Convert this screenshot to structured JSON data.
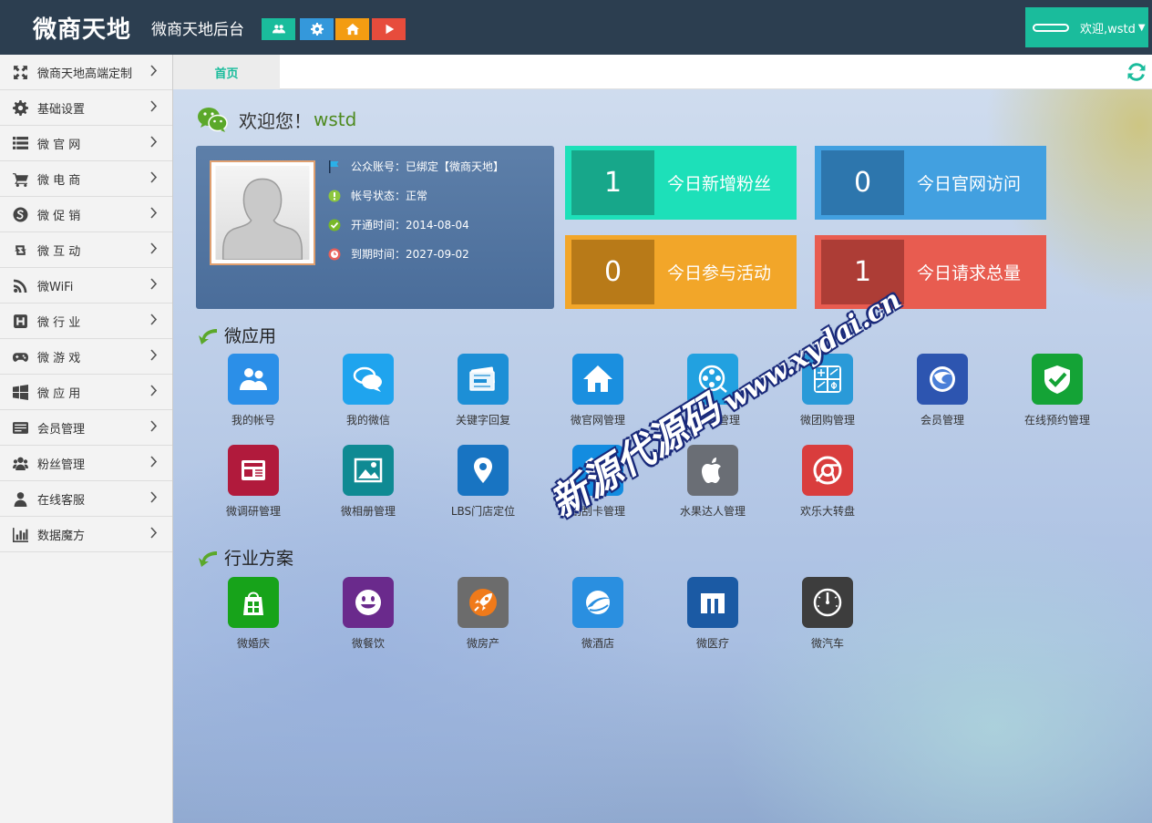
{
  "header": {
    "logo": "微商天地",
    "subtitle": "微商天地后台",
    "buttons": [
      {
        "icon": "users-icon",
        "color": "#1abc9c"
      },
      {
        "icon": "gear-icon",
        "color": "#3498db"
      },
      {
        "icon": "home-icon",
        "color": "#f39c12"
      },
      {
        "icon": "play-icon",
        "color": "#e74c3c"
      }
    ],
    "welcome": "欢迎,wstd",
    "welcome_caret": "▼"
  },
  "sidebar": {
    "items": [
      {
        "label": "微商天地高端定制",
        "icon": "expand-icon"
      },
      {
        "label": "基础设置",
        "icon": "gear-icon"
      },
      {
        "label": "微 官 网",
        "icon": "list-icon"
      },
      {
        "label": "微 电 商",
        "icon": "cart-icon"
      },
      {
        "label": "微 促 销",
        "icon": "skype-icon"
      },
      {
        "label": "微 互 动",
        "icon": "retweet-icon"
      },
      {
        "label": "微WiFi",
        "icon": "rss-icon"
      },
      {
        "label": "微 行 业",
        "icon": "h-square-icon"
      },
      {
        "label": "微 游 戏",
        "icon": "gamepad-icon"
      },
      {
        "label": "微 应 用",
        "icon": "windows-icon"
      },
      {
        "label": "会员管理",
        "icon": "card-icon"
      },
      {
        "label": "粉丝管理",
        "icon": "users-icon"
      },
      {
        "label": "在线客服",
        "icon": "user-icon"
      },
      {
        "label": "数据魔方",
        "icon": "chart-icon"
      }
    ]
  },
  "tabs": {
    "home": "首页"
  },
  "greeting": {
    "prefix": "欢迎您！",
    "user": "wstd"
  },
  "profile": {
    "lines": [
      {
        "text": "公众账号：已绑定【微商天地】",
        "icon": "flag-icon"
      },
      {
        "text": "帐号状态：正常",
        "icon": "info-icon"
      },
      {
        "text": "开通时间：2014-08-04",
        "icon": "check-icon"
      },
      {
        "text": "到期时间：2027-09-02",
        "icon": "clock-icon"
      }
    ]
  },
  "stats": [
    {
      "value": "1",
      "label": "今日新增粉丝",
      "bg": "#1de0b9",
      "dark": "#17a78a"
    },
    {
      "value": "0",
      "label": "今日官网访问",
      "bg": "#42a0e0",
      "dark": "#2d76ad"
    },
    {
      "value": "0",
      "label": "今日参与活动",
      "bg": "#f2a629",
      "dark": "#b87a18"
    },
    {
      "value": "1",
      "label": "今日请求总量",
      "bg": "#e85c50",
      "dark": "#ad3d36"
    }
  ],
  "sections": {
    "apps": "微应用",
    "industry": "行业方案"
  },
  "apps": [
    {
      "label": "我的帐号",
      "icon": "users-icon",
      "color": "#2b8fe8"
    },
    {
      "label": "我的微信",
      "icon": "chat-icon",
      "color": "#1fa4ee"
    },
    {
      "label": "关键字回复",
      "icon": "news-icon",
      "color": "#1d8fd6"
    },
    {
      "label": "微官网管理",
      "icon": "home-icon",
      "color": "#1a8fdf"
    },
    {
      "label": "微商城管理",
      "icon": "film-icon",
      "color": "#22a1e0"
    },
    {
      "label": "微团购管理",
      "icon": "calc-icon",
      "color": "#2a9ad8"
    },
    {
      "label": "会员管理",
      "icon": "thunderbird-icon",
      "color": "#2d55b0"
    },
    {
      "label": "在线预约管理",
      "icon": "shield-check-icon",
      "color": "#14a336"
    },
    {
      "label": "微调研管理",
      "icon": "newspaper-icon",
      "color": "#b11a3c"
    },
    {
      "label": "微相册管理",
      "icon": "picture-icon",
      "color": "#0f8a93"
    },
    {
      "label": "LBS门店定位",
      "icon": "location-icon",
      "color": "#1874c2"
    },
    {
      "label": "刮刮卡管理",
      "icon": "dropbox-icon",
      "color": "#138ce0"
    },
    {
      "label": "水果达人管理",
      "icon": "apple-icon",
      "color": "#6a6e75"
    },
    {
      "label": "欢乐大转盘",
      "icon": "chrome-icon",
      "color": "#d93d3d"
    }
  ],
  "industry": [
    {
      "label": "微婚庆",
      "icon": "store-icon",
      "color": "#17a31a"
    },
    {
      "label": "微餐饮",
      "icon": "smiley-icon",
      "color": "#6a2a8c"
    },
    {
      "label": "微房产",
      "icon": "rocket-icon",
      "color": "#6c6c6c"
    },
    {
      "label": "微酒店",
      "icon": "planet-icon",
      "color": "#2a8fe0"
    },
    {
      "label": "微医疗",
      "icon": "maxthon-icon",
      "color": "#1b5aa4"
    },
    {
      "label": "微汽车",
      "icon": "gauge-icon",
      "color": "#3d3d3d"
    }
  ],
  "watermark": {
    "line1": "新源代源码",
    "line2": "www.xydai.cn"
  }
}
